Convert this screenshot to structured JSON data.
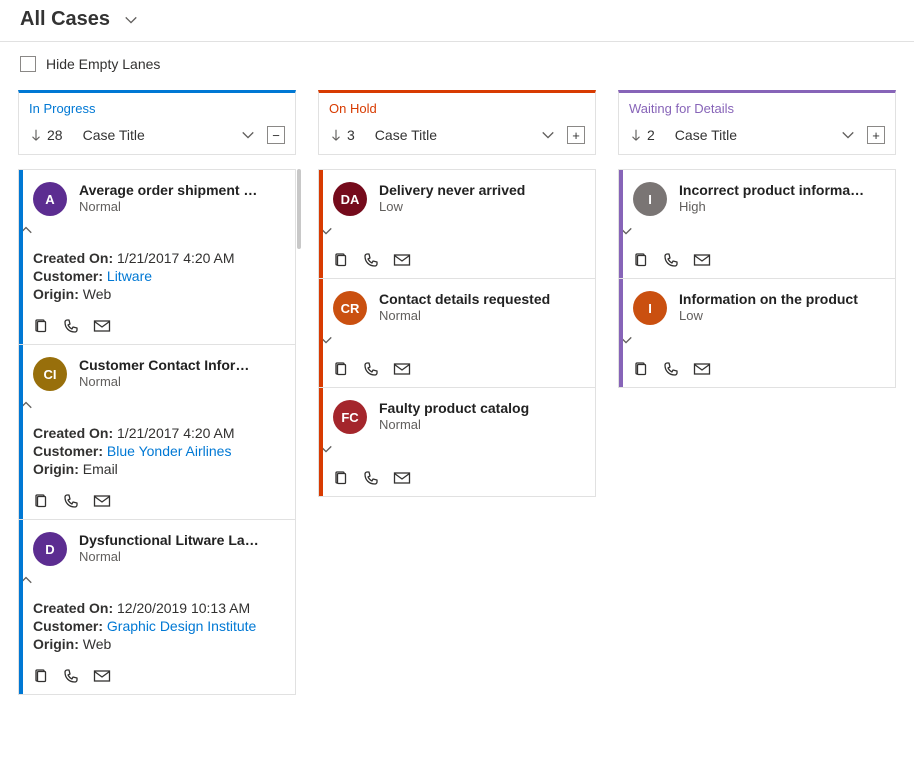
{
  "header": {
    "title": "All Cases"
  },
  "toolbar": {
    "hide_empty": "Hide Empty Lanes"
  },
  "labels": {
    "created_on": "Created On:",
    "customer": "Customer:",
    "origin": "Origin:"
  },
  "lanes": [
    {
      "title": "In Progress",
      "color": "#0078d4",
      "title_color": "#0078d4",
      "count": "28",
      "sort": "Case Title",
      "toggle": "−",
      "scroll": true,
      "cards": [
        {
          "accent": "#0078d4",
          "avatar_bg": "#5c2d91",
          "initials": "A",
          "title": "Average order shipment …",
          "priority": "Normal",
          "expanded": true,
          "chev": "up",
          "created": "1/21/2017 4:20 AM",
          "customer": "Litware",
          "origin": "Web"
        },
        {
          "accent": "#0078d4",
          "avatar_bg": "#986f0b",
          "initials": "CI",
          "title": "Customer Contact Infor…",
          "priority": "Normal",
          "expanded": true,
          "chev": "up",
          "created": "1/21/2017 4:20 AM",
          "customer": "Blue Yonder Airlines",
          "origin": "Email"
        },
        {
          "accent": "#0078d4",
          "avatar_bg": "#5c2d91",
          "initials": "D",
          "title": "Dysfunctional Litware La…",
          "priority": "Normal",
          "expanded": true,
          "chev": "up",
          "created": "12/20/2019 10:13 AM",
          "customer": "Graphic Design Institute",
          "origin": "Web"
        }
      ]
    },
    {
      "title": "On Hold",
      "color": "#d83b01",
      "title_color": "#d83b01",
      "count": "3",
      "sort": "Case Title",
      "toggle": "+",
      "scroll": false,
      "cards": [
        {
          "accent": "#d83b01",
          "avatar_bg": "#750b1c",
          "initials": "DA",
          "title": "Delivery never arrived",
          "priority": "Low",
          "expanded": false,
          "chev": "down"
        },
        {
          "accent": "#d83b01",
          "avatar_bg": "#ca5010",
          "initials": "CR",
          "title": "Contact details requested",
          "priority": "Normal",
          "expanded": false,
          "chev": "down"
        },
        {
          "accent": "#d83b01",
          "avatar_bg": "#a4262c",
          "initials": "FC",
          "title": "Faulty product catalog",
          "priority": "Normal",
          "expanded": false,
          "chev": "down"
        }
      ]
    },
    {
      "title": "Waiting for Details",
      "color": "#8764b8",
      "title_color": "#8764b8",
      "count": "2",
      "sort": "Case Title",
      "toggle": "+",
      "scroll": false,
      "cards": [
        {
          "accent": "#8764b8",
          "avatar_bg": "#7a7574",
          "initials": "I",
          "title": "Incorrect product informa…",
          "priority": "High",
          "expanded": false,
          "chev": "down"
        },
        {
          "accent": "#8764b8",
          "avatar_bg": "#ca5010",
          "initials": "I",
          "title": "Information on the product",
          "priority": "Low",
          "expanded": false,
          "chev": "down"
        }
      ]
    }
  ]
}
